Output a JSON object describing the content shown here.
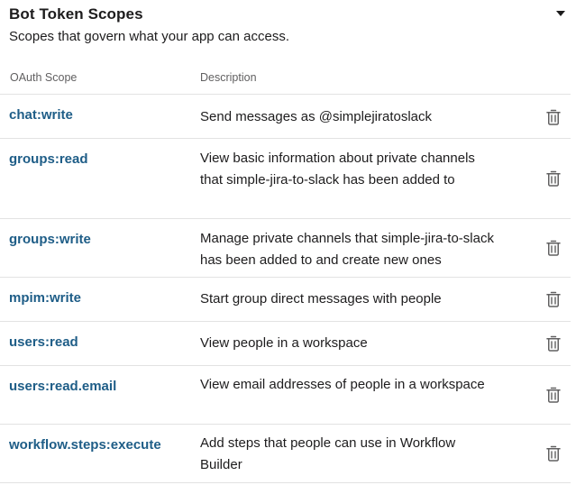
{
  "header": {
    "title": "Bot Token Scopes",
    "subtitle": "Scopes that govern what your app can access."
  },
  "columns": {
    "scope": "OAuth Scope",
    "description": "Description"
  },
  "scopes": [
    {
      "name": "chat:write",
      "description": "Send messages as @simplejiratoslack"
    },
    {
      "name": "groups:read",
      "description": "View basic information about private channels that simple-jira-to-slack has been added to"
    },
    {
      "name": "groups:write",
      "description": "Manage private channels that simple-jira-to-slack has been added to and create new ones"
    },
    {
      "name": "mpim:write",
      "description": "Start group direct messages with people"
    },
    {
      "name": "users:read",
      "description": "View people in a workspace"
    },
    {
      "name": "users:read.email",
      "description": "View email addresses of people in a workspace"
    },
    {
      "name": "workflow.steps:execute",
      "description": "Add steps that people can use in Workflow Builder"
    }
  ],
  "icons": {
    "collapse": "caret-down-icon",
    "remove": "trash-icon"
  },
  "colors": {
    "scope_link": "#1e5d87",
    "text": "#1d1c1d",
    "muted": "#616061",
    "divider": "#e2e2e2"
  }
}
